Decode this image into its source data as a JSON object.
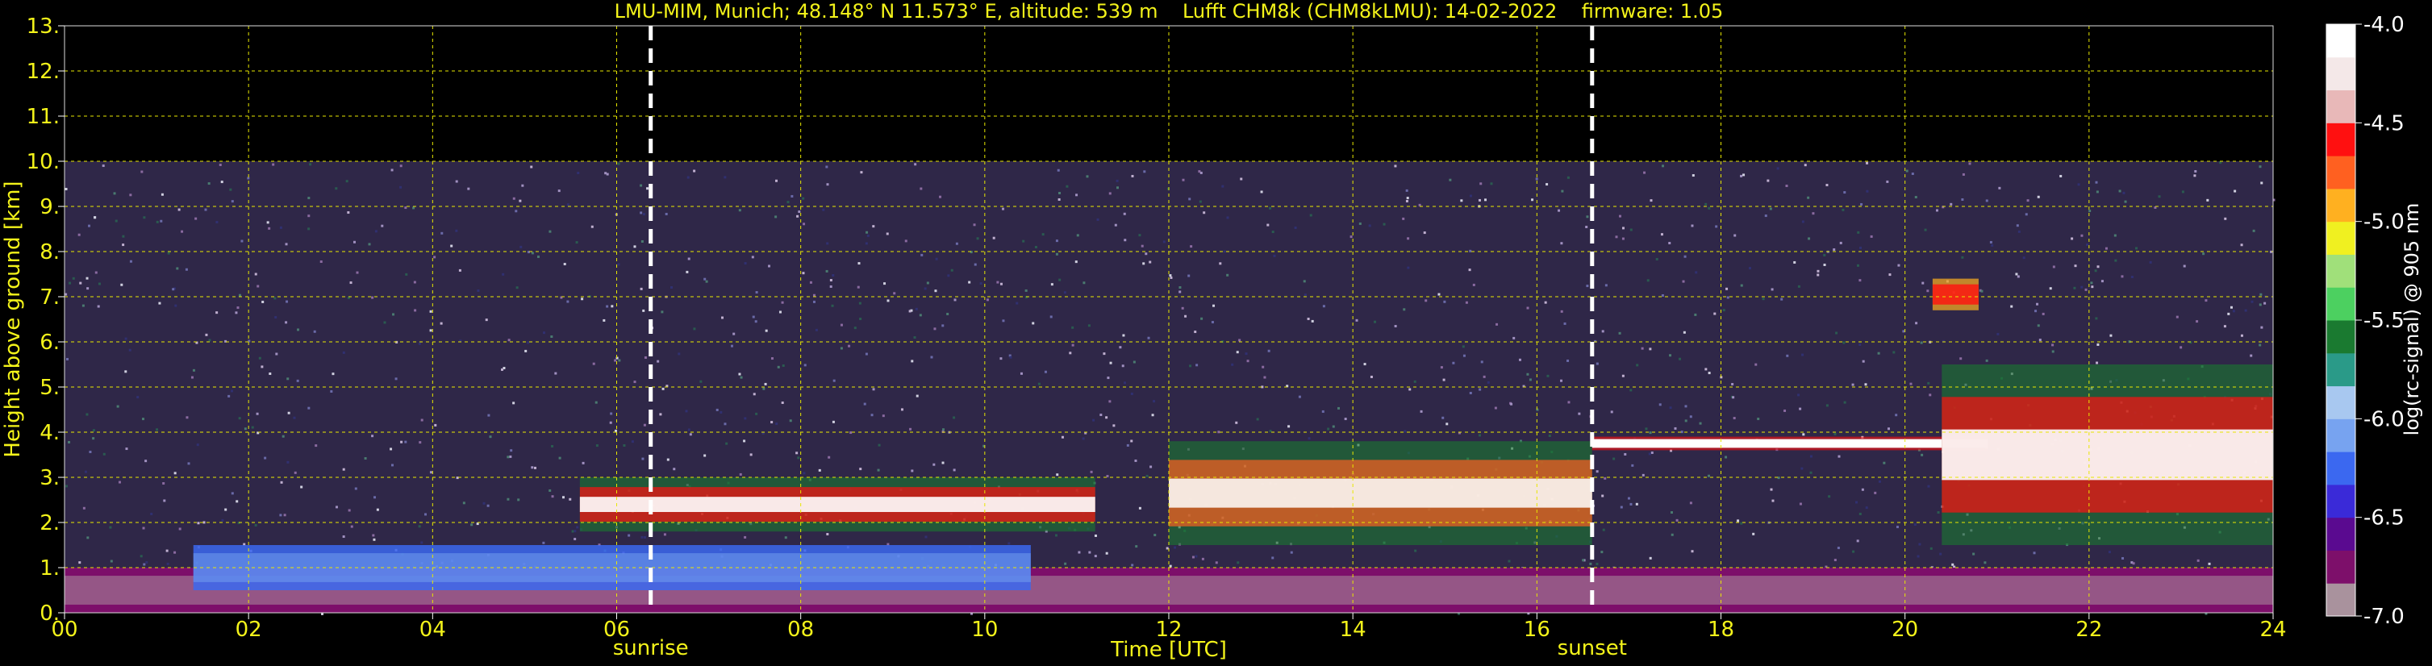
{
  "chart_data": {
    "type": "heatmap",
    "title": "LMU-MIM, Munich; 48.148° N 11.573° E, altitude: 539 m    Lufft CHM8k (CHM8kLMU): 14-02-2022    firmware: 1.05",
    "xlabel": "Time [UTC]",
    "ylabel": "Height above ground [km]",
    "colorbar_label": "log(rc-signal) @ 905 nm",
    "xlim": [
      0,
      24
    ],
    "ylim": [
      0,
      13
    ],
    "clim": [
      -7.0,
      -4.0
    ],
    "x_ticks": [
      "00",
      "02",
      "04",
      "06",
      "08",
      "10",
      "12",
      "14",
      "16",
      "18",
      "20",
      "22",
      "24"
    ],
    "y_ticks": [
      "0.",
      "1.",
      "2.",
      "3.",
      "4.",
      "5.",
      "6.",
      "7.",
      "8.",
      "9.",
      "10.",
      "11.",
      "12.",
      "13."
    ],
    "colorbar_ticks": [
      "-4.0",
      "-4.5",
      "-5.0",
      "-5.5",
      "-6.0",
      "-6.5",
      "-7.0"
    ],
    "markers": [
      {
        "label": "sunrise",
        "time": 6.37
      },
      {
        "label": "sunset",
        "time": 16.6
      }
    ],
    "grid": true,
    "data_top_km": 10.0,
    "colormap": [
      "#a9929d",
      "#7d0f6a",
      "#5a0a90",
      "#3a2ad8",
      "#3b68f0",
      "#77a3f0",
      "#a8c8f0",
      "#2a9a88",
      "#1a7a30",
      "#4cd060",
      "#a0e07a",
      "#f0f020",
      "#ffb020",
      "#ff6020",
      "#ff1010",
      "#e8b8b8",
      "#f4e8e8",
      "#ffffff"
    ],
    "layers": [
      {
        "name": "boundary-layer",
        "t0": 0,
        "t1": 24,
        "base_km": 0.0,
        "top_km": 1.0
      },
      {
        "name": "residual-layer",
        "t0": 1.4,
        "t1": 10.5,
        "base_km": 0.5,
        "top_km": 1.5
      },
      {
        "name": "cloud-band-1",
        "t0": 5.6,
        "t1": 11.2,
        "base_km": 1.8,
        "top_km": 3.0
      },
      {
        "name": "cloud-band-2",
        "t0": 12.0,
        "t1": 16.6,
        "base_km": 1.5,
        "top_km": 3.8
      },
      {
        "name": "cloud-layer-3.8km",
        "t0": 16.6,
        "t1": 20.9,
        "base_km": 3.6,
        "top_km": 3.9
      },
      {
        "name": "cloud-band-3",
        "t0": 20.4,
        "t1": 24.0,
        "base_km": 1.5,
        "top_km": 5.5
      },
      {
        "name": "cloud-7km",
        "t0": 20.3,
        "t1": 20.8,
        "base_km": 6.7,
        "top_km": 7.4
      }
    ]
  }
}
